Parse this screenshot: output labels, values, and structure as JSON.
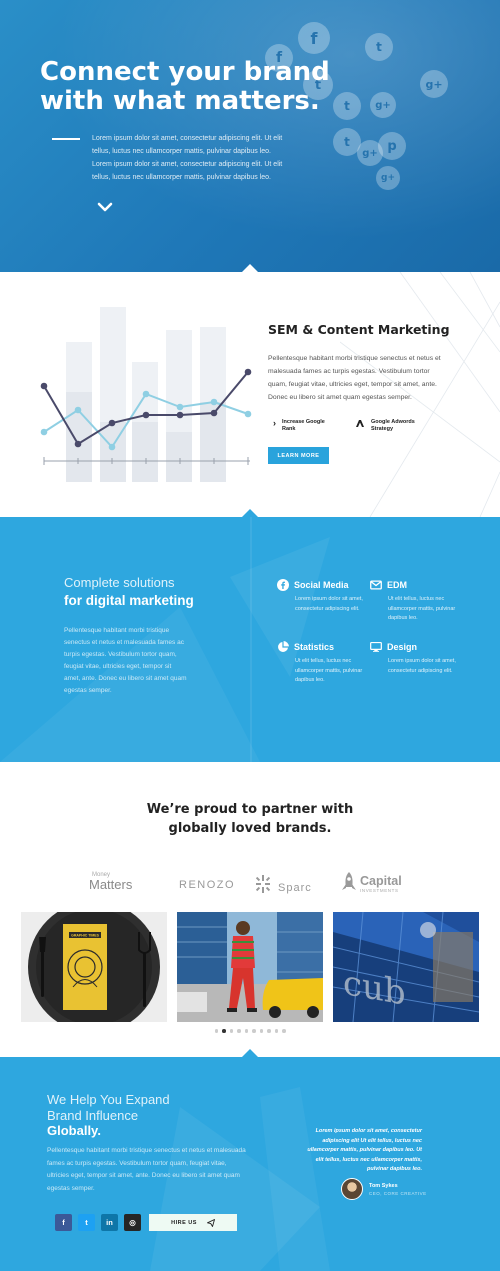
{
  "hero": {
    "title": "Connect your brand with what matters.",
    "body": "Lorem ipsum dolor sit amet, consectetur adipiscing elit. Ut elit tellus, luctus nec ullamcorper mattis, pulvinar dapibus leo. Lorem ipsum dolor sit amet, consectetur adipiscing elit. Ut elit tellus, luctus nec ullamcorper mattis, pulvinar dapibus leo."
  },
  "sem": {
    "title": "SEM & Content Marketing",
    "body": "Pellentesque habitant morbi tristique senectus et netus et malesuada fames ac turpis egestas. Vestibulum tortor quam, feugiat vitae, ultricies eget, tempor sit amet, ante. Donec eu libero sit amet quam egestas semper.",
    "feature1": "Increase Google Rank",
    "feature2": "Google Adwords Strategy",
    "button": "LEARN MORE"
  },
  "solutions": {
    "title_light": "Complete solutions",
    "title_bold": "for digital marketing",
    "body": "Pellentesque habitant morbi tristique senectus et netus et malesuada fames ac turpis egestas. Vestibulum tortor quam, feugiat vitae, ultricies eget, tempor sit amet, ante. Donec eu libero sit amet quam egestas semper.",
    "services": [
      {
        "name": "Social Media",
        "icon": "facebook-icon",
        "text": "Lorem ipsum dolor sit amet, consectetur adipiscing elit."
      },
      {
        "name": "EDM",
        "icon": "mail-icon",
        "text": "Ut elit tellus, luctus nec ullamcorper mattis, pulvinar dapibus leo."
      },
      {
        "name": "Statistics",
        "icon": "pie-chart-icon",
        "text": "Ut elit tellus, luctus nec ullamcorper mattis, pulvinar dapibus leo."
      },
      {
        "name": "Design",
        "icon": "monitor-icon",
        "text": "Lorem ipsum dolor sit amet, consectetur adipiscing elit."
      }
    ]
  },
  "partners": {
    "title_line1": "We’re proud to partner with",
    "title_line2": "globally loved brands.",
    "logos": {
      "money_small": "Money",
      "money_big": "Matters",
      "renozo": "RENOZO",
      "sparc": "Sparc",
      "capital": "Capital",
      "capital_sub": "INVESTMENTS"
    },
    "book_title": "GRAPHIC TIMES",
    "carousel_pages": 10,
    "carousel_active": 2
  },
  "expand": {
    "title_l1": "We Help You Expand",
    "title_l2": "Brand Influence",
    "title_bold": "Globally.",
    "body": "Pellentesque habitant morbi tristique senectus et netus et malesuada fames ac turpis egestas. Vestibulum tortor quam, feugiat vitae, ultricies eget, tempor sit amet, ante. Donec eu libero sit amet quam egestas semper.",
    "quote": "Lorem ipsum dolor sit amet, consectetur adipiscing elit Ut elit tellus, luctus nec ullamcorper mattis, pulvinar dapibus leo. Ut elit tellus, luctus nec ullamcorper mattis, pulvinar dapibus leo.",
    "author_name": "Tom Sykes",
    "author_role": "CEO, CORE CREATIVE",
    "socials": {
      "facebook": "f",
      "twitter": "t",
      "linkedin": "in",
      "instagram": "◎"
    },
    "hire_button": "HIRE US"
  },
  "colors": {
    "accent": "#29a3dc",
    "section_blue": "#2ea7df",
    "hero_blue": "#2385c2",
    "line_dark": "#4a4a6a",
    "line_light": "#8fcfe3"
  }
}
